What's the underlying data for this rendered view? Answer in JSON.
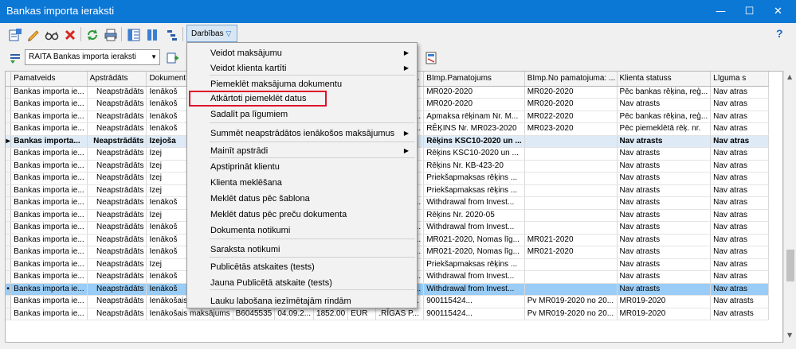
{
  "window": {
    "title": "Bankas importa ieraksti",
    "minimize": "—",
    "maximize": "☐",
    "close": "✕"
  },
  "toolbar": {
    "actions_label": "Darbības",
    "help_label": "?"
  },
  "filter": {
    "selected": "RAITA Bankas importa ieraksti"
  },
  "grid": {
    "columns": [
      "Pamatveids",
      "Apstrādāts",
      "Dokument",
      "",
      "",
      "",
      "",
      "BImp.Klie...",
      "BImp.Pamatojums",
      "BImp.No pamatojuma: ...",
      "Klienta statuss",
      "Līguma s"
    ],
    "rows": [
      {
        "ind": "",
        "c": [
          "Bankas importa ie...",
          "Neapstrādāts",
          "Ienākoš",
          "",
          "",
          "",
          "AD...",
          "",
          "MR020-2020",
          "MR020-2020",
          "Pēc bankas rēķina, reģ...",
          "Nav atras"
        ]
      },
      {
        "ind": "",
        "c": [
          "Bankas importa ie...",
          "Neapstrādāts",
          "Ienākoš",
          "",
          "",
          "",
          "AD...",
          "",
          "MR020-2020",
          "MR020-2020",
          "Nav atrasts",
          "Nav atras"
        ]
      },
      {
        "ind": "",
        "c": [
          "Bankas importa ie...",
          "Neapstrādāts",
          "Ienākoš",
          "",
          "",
          "",
          "T SIA",
          "40103348...",
          "Apmaksa rēķinam Nr. M...",
          "MR022-2020",
          "Pēc bankas rēķina, reģ...",
          "Nav atras"
        ]
      },
      {
        "ind": "",
        "c": [
          "Bankas importa ie...",
          "Neapstrādāts",
          "Ienākoš",
          "",
          "",
          "",
          "",
          "40008225...",
          "RĒĶINS Nr. MR023-2020",
          "MR023-2020",
          "Pēc piemeklētā rēķ. nr.",
          "Nav atras"
        ]
      },
      {
        "ind": "▸",
        "bold": true,
        "c": [
          "Bankas importa...",
          "Neapstrādāts",
          "Izejoša",
          "",
          "",
          "",
          "TA ...",
          "",
          "Rēķins KSC10-2020 un ...",
          "",
          "Nav atrasts",
          "Nav atras"
        ]
      },
      {
        "ind": "",
        "c": [
          "Bankas importa ie...",
          "Neapstrādāts",
          "Izej",
          "",
          "",
          "",
          "A",
          "",
          "Rēķins KSC10-2020 un ...",
          "",
          "Nav atrasts",
          "Nav atras"
        ]
      },
      {
        "ind": "",
        "c": [
          "Bankas importa ie...",
          "Neapstrādāts",
          "Izej",
          "",
          "",
          "",
          "RV",
          "",
          "Rēķins Nr. KB-423-20",
          "",
          "Nav atrasts",
          "Nav atras"
        ]
      },
      {
        "ind": "",
        "c": [
          "Bankas importa ie...",
          "Neapstrādāts",
          "Izej",
          "",
          "",
          "",
          "RV",
          "",
          "Priekšapmaksas rēķins ...",
          "",
          "Nav atrasts",
          "Nav atras"
        ]
      },
      {
        "ind": "",
        "c": [
          "Bankas importa ie...",
          "Neapstrādāts",
          "Izej",
          "",
          "",
          "",
          "RV...",
          "",
          "Priekšapmaksas rēķins ...",
          "",
          "Nav atrasts",
          "Nav atras"
        ]
      },
      {
        "ind": "",
        "c": [
          "Bankas importa ie...",
          "Neapstrādāts",
          "Ienākoš",
          "",
          "",
          "",
          "ntar",
          "40103903...",
          "Withdrawal from Invest...",
          "",
          "Nav atrasts",
          "Nav atras"
        ]
      },
      {
        "ind": "",
        "c": [
          "Bankas importa ie...",
          "Neapstrādāts",
          "Izej",
          "",
          "",
          "",
          "",
          "",
          "Rēķins Nr. 2020-05",
          "",
          "Nav atrasts",
          "Nav atras"
        ]
      },
      {
        "ind": "",
        "c": [
          "Bankas importa ie...",
          "Neapstrādāts",
          "Ienākoš",
          "",
          "",
          "",
          "ntar",
          "40103903...",
          "Withdrawal from Invest...",
          "",
          "Nav atrasts",
          "Nav atras"
        ]
      },
      {
        "ind": "",
        "c": [
          "Bankas importa ie...",
          "Neapstrādāts",
          "Ienākoš",
          "",
          "",
          "",
          "O SIA",
          "40003498...",
          "MR021-2020, Nomas līg...",
          "MR021-2020",
          "Nav atrasts",
          "Nav atras"
        ]
      },
      {
        "ind": "",
        "c": [
          "Bankas importa ie...",
          "Neapstrādāts",
          "Ienākoš",
          "",
          "",
          "",
          "O SIA",
          "40003498...",
          "MR021-2020, Nomas līg...",
          "MR021-2020",
          "Nav atrasts",
          "Nav atras"
        ]
      },
      {
        "ind": "",
        "c": [
          "Bankas importa ie...",
          "Neapstrādāts",
          "Izej",
          "",
          "",
          "",
          "RV...",
          "",
          "Priekšapmaksas rēķins ...",
          "",
          "Nav atrasts",
          "Nav atras"
        ]
      },
      {
        "ind": "",
        "c": [
          "Bankas importa ie...",
          "Neapstrādāts",
          "Ienākoš",
          "",
          "",
          "",
          "ntar",
          "40103903...",
          "Withdrawal from Invest...",
          "",
          "Nav atrasts",
          "Nav atras"
        ]
      },
      {
        "ind": "•",
        "sel": true,
        "c": [
          "Bankas importa ie...",
          "Neapstrādāts",
          "Ienākoš",
          "",
          "",
          "",
          "ntar",
          "40103903...",
          "Withdrawal from Invest...",
          "",
          "Nav atrasts",
          "Nav atras"
        ]
      },
      {
        "ind": "",
        "c": [
          "Bankas importa ie...",
          "Neapstrādāts",
          "Ienākošais maksājums",
          "B6045535",
          "04.09.2...",
          "1852.00",
          "EUR",
          ".RĪGAS P...",
          "900115424...",
          "Pv MR019-2020 no 20...",
          "MR019-2020",
          "Nav atrasts"
        ]
      },
      {
        "ind": "",
        "c": [
          "Bankas importa ie...",
          "Neapstrādāts",
          "Ienākošais maksājums",
          "B6045535",
          "04.09.2...",
          "1852.00",
          "EUR",
          ".RĪGAS P...",
          "900115424...",
          "Pv MR019-2020 no 20...",
          "MR019-2020",
          "Nav atrasts"
        ]
      }
    ]
  },
  "menu": {
    "items": [
      {
        "label": "Veidot maksājumu",
        "submenu": true
      },
      {
        "label": "Veidot klienta kartīti",
        "submenu": true
      },
      {
        "label": "Piemeklēt maksājuma dokumentu"
      },
      {
        "label": "Atkārtoti piemeklēt datus"
      },
      {
        "label": "Sadalīt pa līgumiem"
      },
      {
        "label": "Summēt neapstrādātos ienākošos maksājumus",
        "submenu": true
      },
      {
        "label": "Mainīt apstrādi",
        "submenu": true
      },
      {
        "label": "Apstiprināt klientu"
      },
      {
        "label": "Klienta meklēšana"
      },
      {
        "label": "Meklēt datus pēc šablona"
      },
      {
        "label": "Meklēt datus pēc preču dokumenta"
      },
      {
        "label": "Dokumenta notikumi"
      },
      {
        "label": "Saraksta notikumi"
      },
      {
        "label": "Publicētās atskaites (tests)"
      },
      {
        "label": "Jauna Publicētā atskaite (tests)"
      },
      {
        "label": "Lauku labošana iezīmētajām rindām"
      }
    ]
  },
  "colors": {
    "titlebar": "#0b78d6",
    "highlight_box": "#e0102a",
    "selected_row": "#99cdf7"
  }
}
